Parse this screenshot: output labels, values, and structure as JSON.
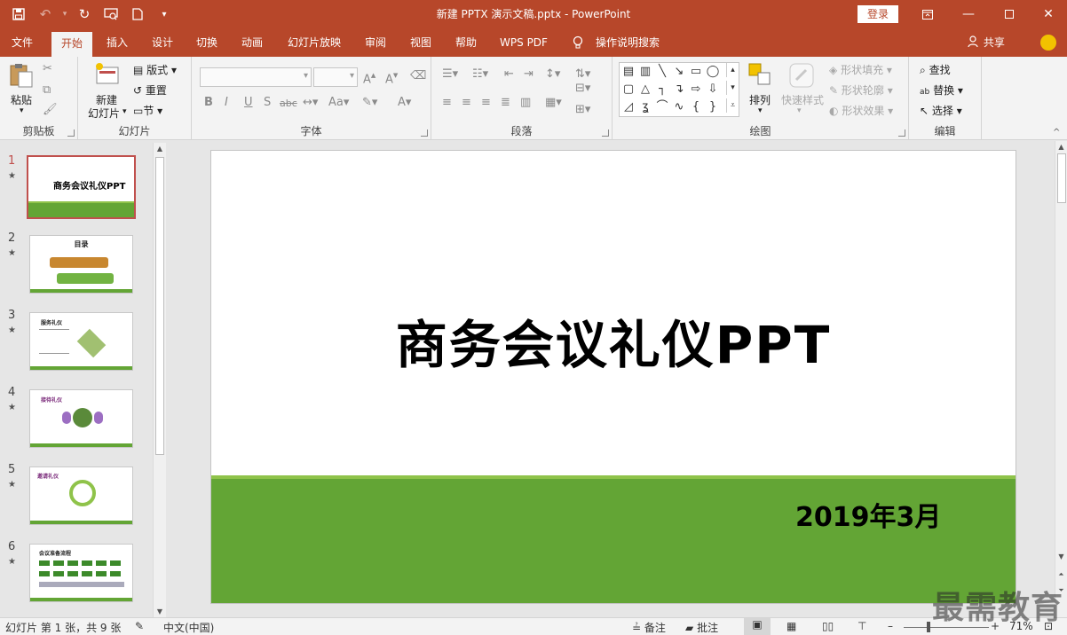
{
  "titlebar": {
    "title": "新建 PPTX 演示文稿.pptx  -  PowerPoint",
    "login": "登录",
    "qat_icons": [
      "save-icon",
      "undo-icon",
      "redo-icon",
      "presenter-icon",
      "new-doc-icon",
      "customize-icon"
    ]
  },
  "tabs": [
    {
      "label": "文件"
    },
    {
      "label": "开始"
    },
    {
      "label": "插入"
    },
    {
      "label": "设计"
    },
    {
      "label": "切换"
    },
    {
      "label": "动画"
    },
    {
      "label": "幻灯片放映"
    },
    {
      "label": "审阅"
    },
    {
      "label": "视图"
    },
    {
      "label": "帮助"
    },
    {
      "label": "WPS PDF"
    },
    {
      "label": "操作说明搜索"
    }
  ],
  "share": "共享",
  "ribbon": {
    "clipboard": {
      "label": "剪贴板",
      "paste": "粘贴"
    },
    "slides": {
      "label": "幻灯片",
      "new_slide_line1": "新建",
      "new_slide_line2": "幻灯片",
      "layout": "版式",
      "reset": "重置",
      "section": "节"
    },
    "font": {
      "label": "字体"
    },
    "paragraph": {
      "label": "段落"
    },
    "drawing": {
      "label": "绘图",
      "arrange": "排列",
      "quick_styles": "快速样式",
      "fill": "形状填充",
      "outline": "形状轮廓",
      "effects": "形状效果"
    },
    "editing": {
      "label": "编辑",
      "find": "查找",
      "replace": "替换",
      "select": "选择"
    }
  },
  "thumbnails": [
    {
      "num": "1",
      "title": "商务会议礼仪PPT"
    },
    {
      "num": "2",
      "title": "目录"
    },
    {
      "num": "3",
      "title": "服务礼仪"
    },
    {
      "num": "4",
      "title": "接待礼仪"
    },
    {
      "num": "5",
      "title": "邀请礼仪"
    },
    {
      "num": "6",
      "title": "会议准备流程"
    }
  ],
  "slide": {
    "title": "商务会议礼仪PPT",
    "date": "2019年3月",
    "band_color": "#63a535",
    "accent_line_color": "#8fc34a"
  },
  "status": {
    "slide_info": "幻灯片 第 1 张，共 9 张",
    "language": "中文(中国)",
    "notes": "备注",
    "comments": "批注",
    "zoom": "71%",
    "zoom_minus": "–",
    "zoom_plus": "+"
  },
  "watermark": "最需教育",
  "colors": {
    "brand": "#b7472a",
    "selected_thumb": "#c0504d"
  }
}
